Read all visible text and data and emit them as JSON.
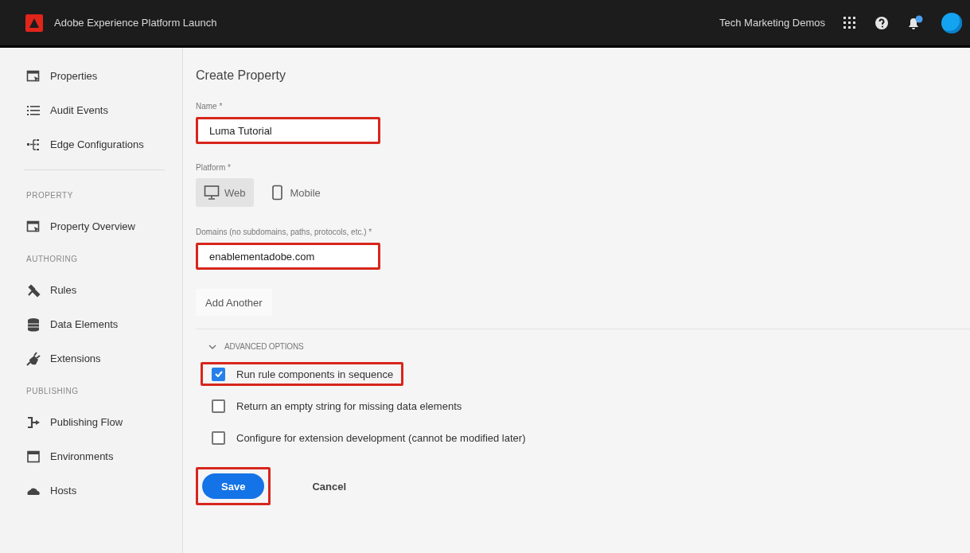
{
  "top_bar": {
    "app_title": "Adobe Experience Platform Launch",
    "org": "Tech Marketing Demos",
    "notification_badge": true
  },
  "sidebar": {
    "groups": [
      {
        "items": [
          {
            "label": "Properties"
          },
          {
            "label": "Audit Events"
          },
          {
            "label": "Edge Configurations"
          }
        ]
      },
      {
        "heading": "PROPERTY",
        "items": [
          {
            "label": "Property Overview"
          }
        ]
      },
      {
        "heading": "AUTHORING",
        "items": [
          {
            "label": "Rules"
          },
          {
            "label": "Data Elements"
          },
          {
            "label": "Extensions"
          }
        ]
      },
      {
        "heading": "PUBLISHING",
        "items": [
          {
            "label": "Publishing Flow"
          },
          {
            "label": "Environments"
          },
          {
            "label": "Hosts"
          }
        ]
      }
    ]
  },
  "form": {
    "title": "Create Property",
    "name": {
      "label": "Name *",
      "value": "Luma Tutorial",
      "highlighted": true
    },
    "platform": {
      "label": "Platform *",
      "options": [
        {
          "label": "Web",
          "selected": true
        },
        {
          "label": "Mobile",
          "selected": false
        }
      ]
    },
    "domains": {
      "label": "Domains (no subdomains, paths, protocols, etc.) *",
      "value": "enablementadobe.com",
      "highlighted": true
    },
    "add_another": "Add Another",
    "advanced": {
      "label": "ADVANCED OPTIONS",
      "expanded": true,
      "options": [
        {
          "label": "Run rule components in sequence",
          "checked": true,
          "highlighted": true
        },
        {
          "label": "Return an empty string for missing data elements",
          "checked": false,
          "highlighted": false
        },
        {
          "label": "Configure for extension development (cannot be modified later)",
          "checked": false,
          "highlighted": false
        }
      ]
    },
    "save": {
      "label": "Save",
      "highlighted": true
    },
    "cancel": "Cancel"
  }
}
